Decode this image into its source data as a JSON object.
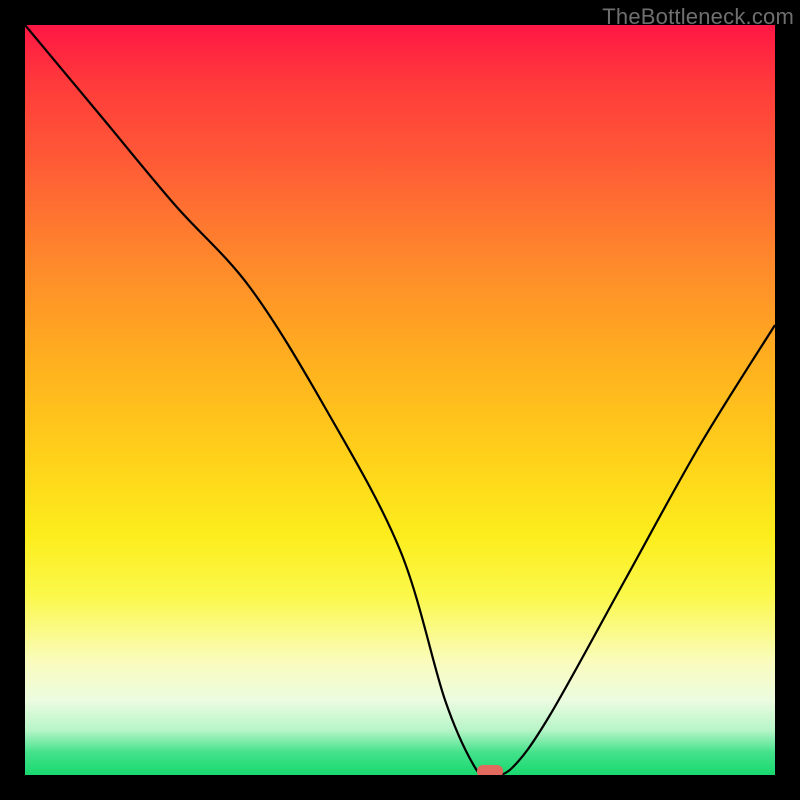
{
  "watermark": "TheBottleneck.com",
  "chart_data": {
    "type": "line",
    "title": "",
    "xlabel": "",
    "ylabel": "",
    "xlim": [
      0,
      100
    ],
    "ylim": [
      0,
      100
    ],
    "series": [
      {
        "name": "bottleneck-curve",
        "x": [
          0,
          10,
          20,
          30,
          40,
          50,
          56,
          60,
          62,
          65,
          70,
          80,
          90,
          100
        ],
        "y": [
          100,
          88,
          76,
          65,
          49,
          30,
          10,
          1,
          0,
          1,
          8,
          26,
          44,
          60
        ]
      }
    ],
    "marker": {
      "x": 62,
      "y": 0
    },
    "gradient": {
      "top_color": "#ff1744",
      "bottom_color": "#18d86e"
    }
  }
}
